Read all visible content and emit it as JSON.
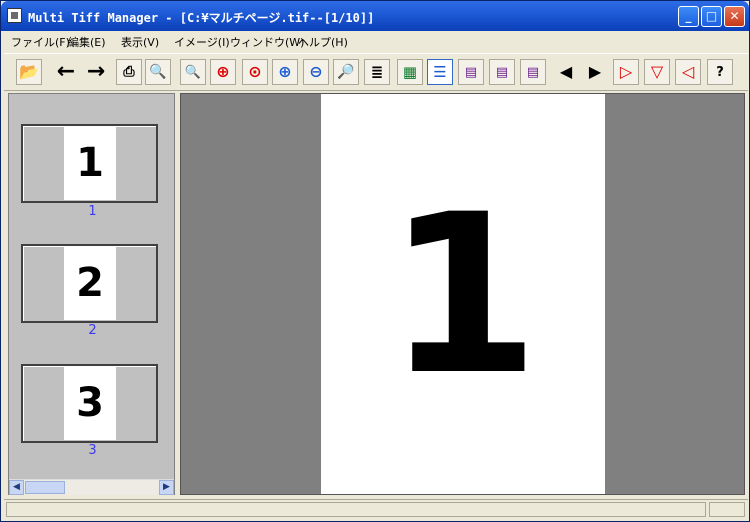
{
  "window": {
    "title": "Multi Tiff Manager - [C:¥マルチページ.tif--[1/10]]",
    "min_glyph": "_",
    "max_glyph": "□",
    "close_glyph": "✕"
  },
  "menu": [
    {
      "label": "ファイル(F)"
    },
    {
      "label": "編集(E)"
    },
    {
      "label": "表示(V)"
    },
    {
      "label": "イメージ(I)"
    },
    {
      "label": "ウィンドウ(W)"
    },
    {
      "label": "ヘルプ(H)"
    }
  ],
  "toolbar": {
    "help_glyph": "?"
  },
  "thumbnails": [
    {
      "number": "1",
      "label": "1"
    },
    {
      "number": "2",
      "label": "2"
    },
    {
      "number": "3",
      "label": "3"
    }
  ],
  "view": {
    "page_number": "1"
  },
  "colors": {
    "title_bar": "#1F5BD6",
    "thumb_label": "#3A3AEE",
    "view_background": "#808080"
  }
}
